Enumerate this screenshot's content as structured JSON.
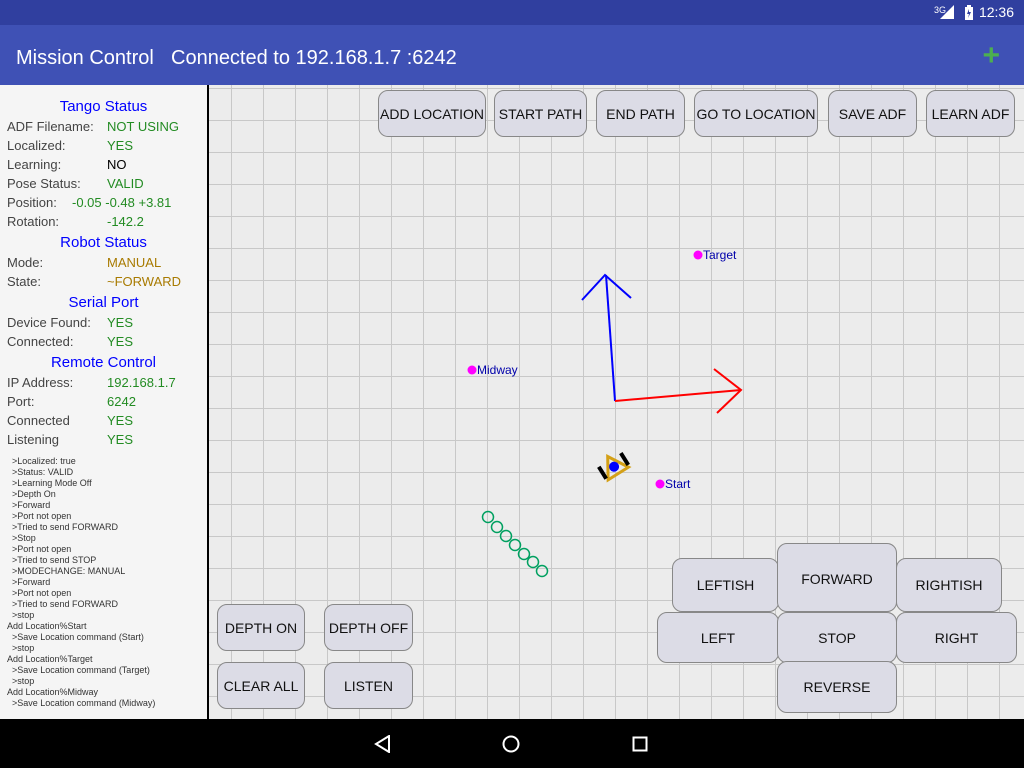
{
  "status_bar": {
    "time": "12:36",
    "network": "3G",
    "battery_icon": "battery-icon"
  },
  "app_bar": {
    "title": "Mission Control",
    "connection": "Connected to 192.168.1.7 :6242",
    "add_icon": "+"
  },
  "sidebar": {
    "tango_title": "Tango Status",
    "tango": [
      {
        "k": "ADF Filename:",
        "v": "NOT USING",
        "c": "g"
      },
      {
        "k": "Localized:",
        "v": "YES",
        "c": "g"
      },
      {
        "k": "Learning:",
        "v": "NO",
        "c": "b"
      },
      {
        "k": "Pose Status:",
        "v": "VALID",
        "c": "g"
      },
      {
        "k": "Position:",
        "v": "-0.05 -0.48 +3.81",
        "c": "g"
      },
      {
        "k": "Rotation:",
        "v": "-142.2",
        "c": "g"
      }
    ],
    "robot_title": "Robot Status",
    "robot": [
      {
        "k": "Mode:",
        "v": "MANUAL",
        "c": "o"
      },
      {
        "k": "State:",
        "v": "~FORWARD",
        "c": "o"
      }
    ],
    "serial_title": "Serial Port",
    "serial": [
      {
        "k": "Device Found:",
        "v": "YES",
        "c": "g"
      },
      {
        "k": "Connected:",
        "v": "YES",
        "c": "g"
      }
    ],
    "remote_title": "Remote Control",
    "remote": [
      {
        "k": "IP Address:",
        "v": "192.168.1.7",
        "c": "g"
      },
      {
        "k": "Port:",
        "v": "6242",
        "c": "g"
      },
      {
        "k": "Connected",
        "v": "YES",
        "c": "g"
      },
      {
        "k": "Listening",
        "v": "YES",
        "c": "g"
      }
    ],
    "log": [
      "  >Localized: true",
      "  >Status: VALID",
      "  >Learning Mode Off",
      "  >Depth On",
      "  >Forward",
      "  >Port not open",
      "  >Tried to send FORWARD",
      "  >Stop",
      "  >Port not open",
      "  >Tried to send STOP",
      "  >MODECHANGE: MANUAL",
      "  >Forward",
      "  >Port not open",
      "  >Tried to send FORWARD",
      "  >stop",
      "Add Location%Start",
      "  >Save Location command (Start)",
      "  >stop",
      "Add Location%Target",
      "  >Save Location command (Target)",
      "  >stop",
      "Add Location%Midway",
      "  >Save Location command (Midway)"
    ]
  },
  "top_buttons": [
    "ADD LOCATION",
    "START PATH",
    "END PATH",
    "GO TO LOCATION",
    "SAVE ADF",
    "LEARN ADF"
  ],
  "left_buttons": [
    "DEPTH ON",
    "DEPTH OFF",
    "CLEAR ALL",
    "LISTEN"
  ],
  "drive_buttons": {
    "leftish": "LEFTISH",
    "forward": "FORWARD",
    "rightish": "RIGHTISH",
    "left": "LEFT",
    "stop": "STOP",
    "right": "RIGHT",
    "reverse": "REVERSE"
  },
  "locations": [
    {
      "name": "Target"
    },
    {
      "name": "Midway"
    },
    {
      "name": "Start"
    }
  ],
  "colors": {
    "location": "#ff00ff",
    "axis_x": "#ff0000",
    "axis_y": "#0000ff",
    "path": "#00a060",
    "robot": "#d4a017"
  }
}
